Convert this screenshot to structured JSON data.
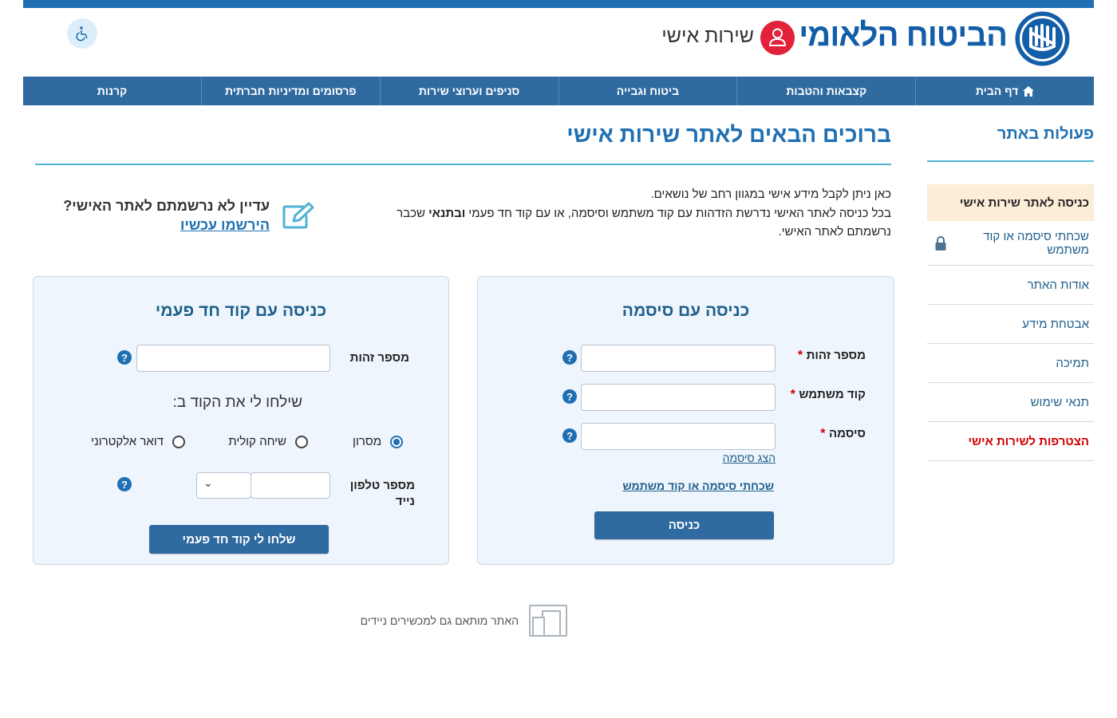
{
  "header": {
    "logo_text": "הביטוח הלאומי",
    "logo_emblem": "emblem-icon",
    "personal_service_label": "שירות אישי",
    "accessibility_icon": "accessibility-icon"
  },
  "nav": {
    "items": [
      {
        "label": "דף הבית",
        "icon": "home-icon"
      },
      {
        "label": "קצבאות והטבות"
      },
      {
        "label": "ביטוח וגבייה"
      },
      {
        "label": "סניפים וערוצי שירות"
      },
      {
        "label": "פרסומים ומדיניות חברתית"
      },
      {
        "label": "קרנות"
      }
    ]
  },
  "sidebar": {
    "title": "פעולות באתר",
    "items": [
      {
        "label": "כניסה לאתר שירות אישי",
        "state": "active"
      },
      {
        "label": "שכחתי סיסמה או קוד משתמש",
        "icon": "lock-icon"
      },
      {
        "label": "אודות האתר"
      },
      {
        "label": "אבטחת מידע"
      },
      {
        "label": "תמיכה"
      },
      {
        "label": "תנאי שימוש"
      },
      {
        "label": "הצטרפות לשירות אישי",
        "color": "#d10000"
      }
    ]
  },
  "main": {
    "title": "ברוכים הבאים לאתר שירות אישי",
    "intro_line1": "כאן ניתן לקבל מידע אישי במגוון רחב של נושאים.",
    "intro_line2_a": "בכל כניסה לאתר האישי נדרשת הזדהות עם קוד משתמש וסיסמה, או עם קוד חד פעמי ",
    "intro_line2_bold": "ובתנאי",
    "intro_line2_b": " שכבר נרשמתם לאתר האישי.",
    "register_question": "עדיין לא נרשמתם לאתר האישי?",
    "register_link": "הירשמו עכשיו"
  },
  "password_login": {
    "title": "כניסה עם סיסמה",
    "id_label": "מספר זהות",
    "user_code_label": "קוד משתמש",
    "password_label": "סיסמה",
    "required_mark": "*",
    "show_password": "הצג סיסמה",
    "forgot_link": "שכחתי סיסמה או קוד משתמש",
    "submit_label": "כניסה",
    "help_glyph": "?"
  },
  "otp_login": {
    "title": "כניסה עם קוד חד פעמי",
    "id_label": "מספר זהות",
    "send_to_label": "שילחו לי את הקוד ב:",
    "options": [
      {
        "label": "מסרון",
        "selected": true
      },
      {
        "label": "שיחה קולית",
        "selected": false
      },
      {
        "label": "דואר אלקטרוני",
        "selected": false
      }
    ],
    "phone_label_1": "מספר טלפון",
    "phone_label_2": "נייד",
    "prefix_chevron": "⌄",
    "submit_label": "שלחו לי קוד חד פעמי",
    "help_glyph": "?"
  },
  "footer": {
    "mobile_note": "האתר מותאם גם למכשירים ניידים"
  },
  "colors": {
    "brand_blue": "#1f6fb2",
    "nav_blue": "#2f6aa0",
    "alert_red": "#d10000",
    "active_bg": "#fbedd6",
    "panel_bg": "#eef5fc"
  }
}
